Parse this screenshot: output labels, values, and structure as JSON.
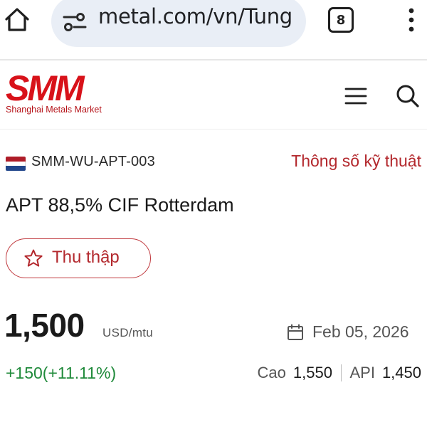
{
  "browser": {
    "url": "metal.com/vn/Tung",
    "tab_count": "8",
    "icons": {
      "home": "home-icon",
      "site_settings": "tune-icon",
      "overflow": "kebab-menu-icon"
    }
  },
  "site": {
    "logo_mark": "SMM",
    "logo_sub": "Shanghai Metals Market",
    "brand_color": "#d8121a",
    "icons": {
      "menu": "hamburger-icon",
      "search": "search-icon"
    }
  },
  "product": {
    "code": "SMM-WU-APT-003",
    "flag": {
      "name": "netherlands-flag-icon",
      "colors": [
        "#ae1c28",
        "#ffffff",
        "#21468b"
      ]
    },
    "specs_link": "Thông số kỹ thuật",
    "title": "APT 88,5% CIF Rotterdam",
    "collect_label": "Thu thập",
    "price": "1,500",
    "unit": "USD/mtu",
    "date": "Feb 05, 2026",
    "change": "+150(+11.11%)",
    "change_color": "#1f8a3a",
    "high_label": "Cao",
    "high_value": "1,550",
    "api_label": "API",
    "api_value": "1,450",
    "accent_color": "#b3282d"
  }
}
